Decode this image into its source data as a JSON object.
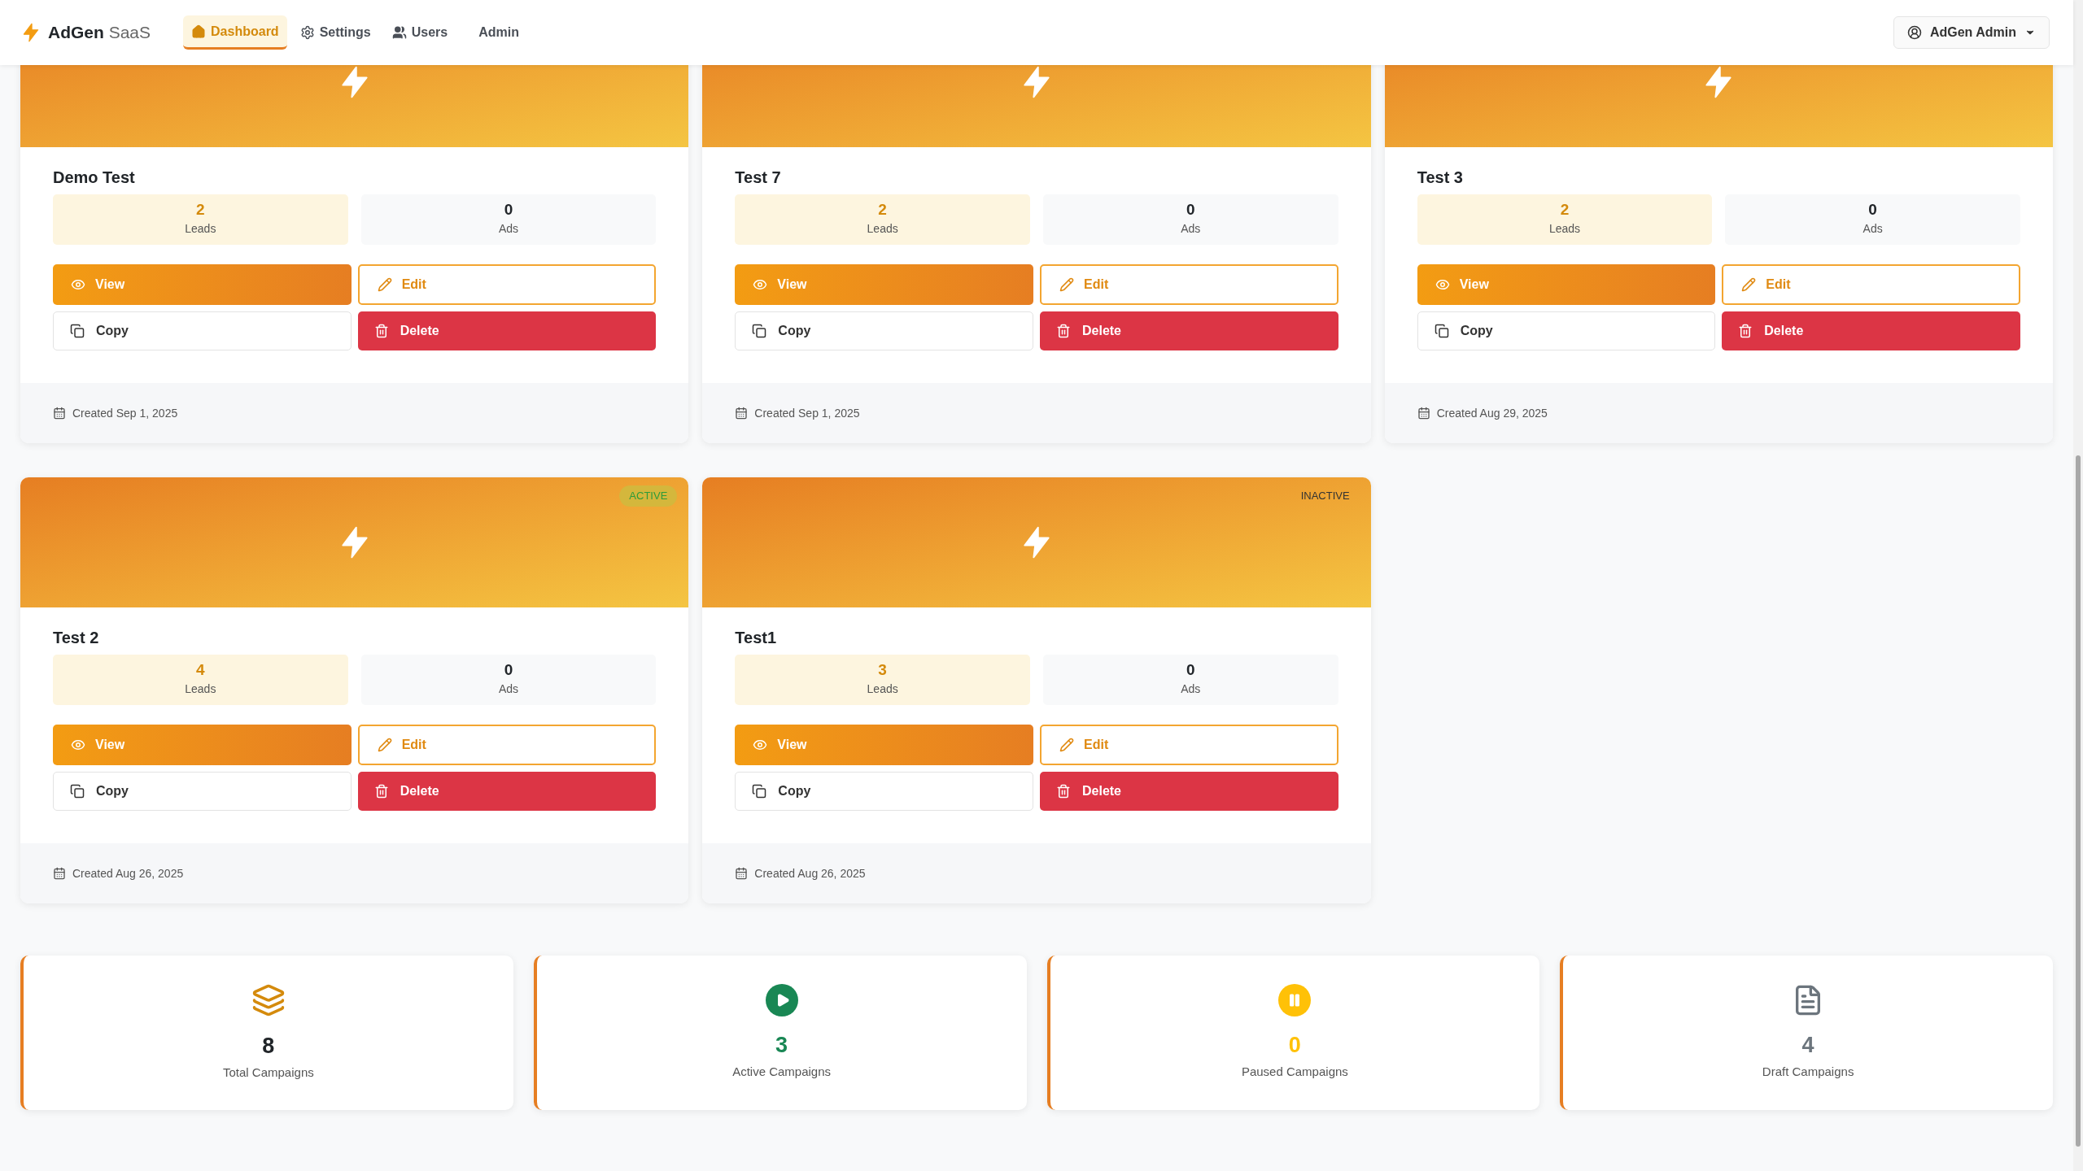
{
  "brand": {
    "name": "AdGen",
    "suffix": "SaaS"
  },
  "nav": [
    {
      "label": "Dashboard",
      "kind": "home",
      "selected": true
    },
    {
      "label": "Settings",
      "kind": "gear",
      "selected": false
    },
    {
      "label": "Users",
      "kind": "users",
      "selected": false
    },
    {
      "label": "Admin",
      "kind": "plain",
      "selected": false
    }
  ],
  "user_menu": {
    "label": "AdGen Admin"
  },
  "campaigns": [
    {
      "title": "Demo Test",
      "leads": "2",
      "leads_label": "Leads",
      "ads": "0",
      "ads_label": "Ads",
      "view": "View",
      "edit": "Edit",
      "copy": "Copy",
      "delete": "Delete",
      "created": "Created Sep 1, 2025"
    },
    {
      "title": "Test 7",
      "leads": "2",
      "leads_label": "Leads",
      "ads": "0",
      "ads_label": "Ads",
      "view": "View",
      "edit": "Edit",
      "copy": "Copy",
      "delete": "Delete",
      "created": "Created Sep 1, 2025"
    },
    {
      "title": "Test 3",
      "leads": "2",
      "leads_label": "Leads",
      "ads": "0",
      "ads_label": "Ads",
      "view": "View",
      "edit": "Edit",
      "copy": "Copy",
      "delete": "Delete",
      "created": "Created Aug 29, 2025"
    },
    {
      "title": "Test 2",
      "status": {
        "kind": "active",
        "label": "ACTIVE"
      },
      "leads": "4",
      "leads_label": "Leads",
      "ads": "0",
      "ads_label": "Ads",
      "view": "View",
      "edit": "Edit",
      "copy": "Copy",
      "delete": "Delete",
      "created": "Created Aug 26, 2025"
    },
    {
      "title": "Test1",
      "status": {
        "kind": "inactive",
        "label": "INACTIVE"
      },
      "leads": "3",
      "leads_label": "Leads",
      "ads": "0",
      "ads_label": "Ads",
      "view": "View",
      "edit": "Edit",
      "copy": "Copy",
      "delete": "Delete",
      "created": "Created Aug 26, 2025"
    }
  ],
  "stats": [
    {
      "kind": "total",
      "value": "8",
      "label": "Total Campaigns",
      "color": "#212529"
    },
    {
      "kind": "active",
      "value": "3",
      "label": "Active Campaigns",
      "color": "#198754"
    },
    {
      "kind": "paused",
      "value": "0",
      "label": "Paused Campaigns",
      "color": "#ffc107"
    },
    {
      "kind": "draft",
      "value": "4",
      "label": "Draft Campaigns",
      "color": "#6c757d"
    }
  ]
}
